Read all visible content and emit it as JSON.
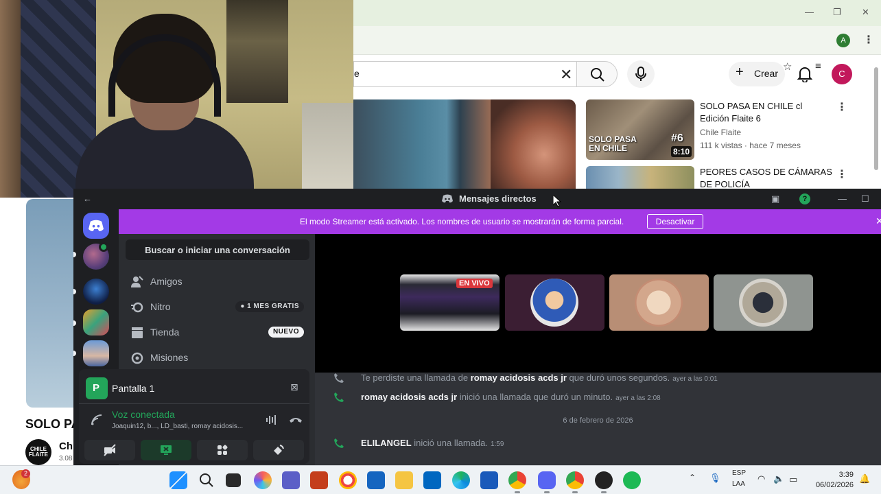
{
  "youtube": {
    "search_value": "e",
    "create_label": "Crear",
    "avatar_letter": "C",
    "browser_profile_letter": "A",
    "recommendations": [
      {
        "title": "SOLO PASA EN CHILE cl Edición Flaite 6",
        "channel": "Chile Flaite",
        "meta": "111 k vistas · hace 7 meses",
        "thumb_overlay": "SOLO PASA EN CHILE",
        "thumb_number": "#6",
        "duration": "8:10"
      },
      {
        "title": "PEORES CASOS DE CÁMARAS DE POLICÍA"
      }
    ],
    "left_video_title": "SOLO PA",
    "left_channel_logo": "CHILE FLAITE",
    "left_channel": "Chi",
    "left_meta": "3.08"
  },
  "discord": {
    "window_title": "Mensajes directos",
    "streamer_banner": "El modo Streamer está activado. Los nombres de usuario se mostrarán de forma parcial.",
    "streamer_button": "Desactivar",
    "search_label": "Buscar o iniciar una conversación",
    "nav": [
      {
        "label": "Amigos",
        "icon": "friends-icon"
      },
      {
        "label": "Nitro",
        "icon": "nitro-icon",
        "pill": "1 MES GRATIS"
      },
      {
        "label": "Tienda",
        "icon": "shop-icon",
        "pill": "NUEVO"
      },
      {
        "label": "Misiones",
        "icon": "quests-icon"
      }
    ],
    "live_badge": "EN VIVO",
    "messages": [
      {
        "prefix": "Te perdiste una llamada de ",
        "user": "romay acidosis acds jr",
        "suffix": " que duró unos segundos.",
        "time": "ayer a las 0:01"
      },
      {
        "prefix": "",
        "user": "romay acidosis acds jr",
        "suffix": " inició una llamada que duró un minuto.",
        "time": "ayer a las 2:08"
      },
      {
        "prefix": "",
        "user": "ELILANGEL",
        "suffix": " inició una llamada.",
        "time": "1:59"
      }
    ],
    "date_divider": "6 de febrero de 2026",
    "stream_label": "Pantalla 1",
    "voice_status": "Voz conectada",
    "voice_users": "Joaquin12, b..., LD_basti, romay acidosis..."
  },
  "taskbar": {
    "notification_count": "2",
    "lang": "ESP",
    "layout": "LAA",
    "time": "3:39",
    "date": "06/02/2026"
  }
}
